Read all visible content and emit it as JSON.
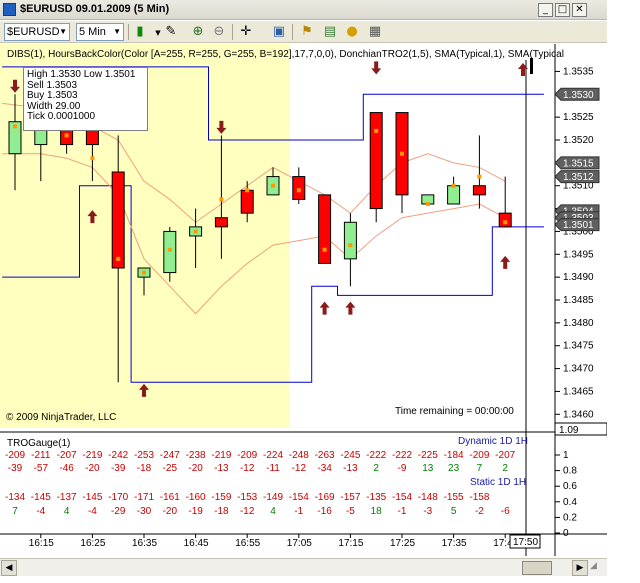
{
  "window": {
    "title": "$EURUSD  09.01.2009 (5 Min)",
    "minimize": "_",
    "restore": "□",
    "close": "✕"
  },
  "toolbar": {
    "instrument": "$EURUSD",
    "interval": "5 Min"
  },
  "indicator_label": "DIBS(1), HoursBackColor(Color [A=255, R=255, G=255, B=192],17,7,0,0), DonchianTRO2(1,5), SMA(Typical,1), SMA(Typical",
  "data_window": {
    "line1": "High 1.3530 Low 1.3501",
    "line2": "Sell 1.3503",
    "line3": "Buy 1.3503",
    "line4": "Width 29.00",
    "line5": "Tick 0.0001000"
  },
  "copyright": "© 2009 NinjaTrader, LLC",
  "time_remaining": "Time remaining = 00:00:00",
  "price_axis": {
    "ticks": [
      "1.3535",
      "1.3530",
      "1.3525",
      "1.3520",
      "1.3515",
      "1.3510",
      "1.3505",
      "1.3500",
      "1.3495",
      "1.3490",
      "1.3485",
      "1.3480",
      "1.3475",
      "1.3470",
      "1.3465",
      "1.3460"
    ],
    "markers": [
      {
        "label": "1.3530",
        "value": 1.353
      },
      {
        "label": "1.3515",
        "value": 1.3515
      },
      {
        "label": "1.3512",
        "value": 1.3512
      },
      {
        "label": "1.3504",
        "value": 1.35045
      },
      {
        "label": "1.3503",
        "value": 1.3503
      },
      {
        "label": "1.3501",
        "value": 1.35015
      }
    ]
  },
  "gauge": {
    "title": "TROGauge(1)",
    "axis_value": "1.09",
    "dynamic_label": "Dynamic 1D 1H",
    "static_label": "Static 1D 1H",
    "axis_ticks": [
      "1",
      "0.8",
      "0.6",
      "0.4",
      "0.2",
      "0"
    ],
    "row1": [
      "-209",
      "-211",
      "-207",
      "-219",
      "-242",
      "-253",
      "-247",
      "-238",
      "-219",
      "-209",
      "-224",
      "-248",
      "-263",
      "-245",
      "-222",
      "-222",
      "-225",
      "-184",
      "-209",
      "-207"
    ],
    "row2": [
      "-39",
      "-57",
      "-46",
      "-20",
      "-39",
      "-18",
      "-25",
      "-20",
      "-13",
      "-12",
      "-11",
      "-12",
      "-34",
      "-13",
      "2",
      "-9",
      "13",
      "23",
      "7",
      "2"
    ],
    "row3": [
      "-134",
      "-145",
      "-137",
      "-145",
      "-170",
      "-171",
      "-161",
      "-160",
      "-159",
      "-153",
      "-149",
      "-154",
      "-169",
      "-157",
      "-135",
      "-154",
      "-148",
      "-155",
      "-158"
    ],
    "row4": [
      "7",
      "-4",
      "4",
      "-4",
      "-29",
      "-30",
      "-20",
      "-19",
      "-18",
      "-12",
      "4",
      "-1",
      "-16",
      "-5",
      "18",
      "-1",
      "-3",
      "5",
      "-2",
      "-6"
    ]
  },
  "time_axis": {
    "labels": [
      "16:15",
      "16:25",
      "16:35",
      "16:45",
      "16:55",
      "17:05",
      "17:15",
      "17:25",
      "17:35",
      "17:4"
    ],
    "current": "17:50"
  },
  "colors": {
    "highlight_bg": "#ffffc0",
    "up_candle": "#90ee90",
    "down_candle": "#ff0000",
    "donchian": "#0000cc",
    "sma": "#f0a080",
    "arrow": "#8b1a1a",
    "positive": "#008000",
    "negative": "#cc0000",
    "label_blue": "#1a1aa6"
  },
  "chart_data": {
    "type": "candlestick",
    "x": [
      "16:10",
      "16:15",
      "16:20",
      "16:25",
      "16:30",
      "16:35",
      "16:40",
      "16:45",
      "16:50",
      "16:55",
      "17:00",
      "17:05",
      "17:10",
      "17:15",
      "17:20",
      "17:25",
      "17:30",
      "17:35",
      "17:40",
      "17:45",
      "17:50"
    ],
    "ylim": [
      1.3457,
      1.3541
    ],
    "ohlc": [
      [
        1.3517,
        1.353,
        1.3509,
        1.3524
      ],
      [
        1.3519,
        1.3529,
        1.3511,
        1.3524
      ],
      [
        1.3527,
        1.353,
        1.3517,
        1.3519
      ],
      [
        1.3524,
        1.3526,
        1.3511,
        1.3519
      ],
      [
        1.3513,
        1.3521,
        1.3467,
        1.3492
      ],
      [
        1.349,
        1.3492,
        1.3486,
        1.3492
      ],
      [
        1.3491,
        1.3501,
        1.3489,
        1.35
      ],
      [
        1.3499,
        1.3505,
        1.3492,
        1.3501
      ],
      [
        1.3503,
        1.3521,
        1.3494,
        1.3501
      ],
      [
        1.3509,
        1.3511,
        1.3502,
        1.3504
      ],
      [
        1.3508,
        1.3514,
        1.3508,
        1.3512
      ],
      [
        1.3512,
        1.3514,
        1.3506,
        1.3507
      ],
      [
        1.3508,
        1.3508,
        1.3493,
        1.3493
      ],
      [
        1.3494,
        1.3504,
        1.3488,
        1.3502
      ],
      [
        1.3526,
        1.3526,
        1.3502,
        1.3505
      ],
      [
        1.3526,
        1.3526,
        1.3504,
        1.3508
      ],
      [
        1.3506,
        1.3508,
        1.3506,
        1.3508
      ],
      [
        1.3506,
        1.3512,
        1.3506,
        1.351
      ],
      [
        1.351,
        1.3521,
        1.3505,
        1.3508
      ],
      [
        1.3504,
        1.3512,
        1.3501,
        1.3501
      ]
    ],
    "bar_markers": [
      1.3523,
      1.3523,
      1.3521,
      1.3516,
      1.3494,
      1.3491,
      1.3496,
      1.35,
      1.3507,
      1.3509,
      1.351,
      1.3509,
      1.3496,
      1.3497,
      1.3522,
      1.3517,
      1.3506,
      1.351,
      1.3512,
      1.3502
    ],
    "donchian_upper": [
      1.3536,
      1.3536,
      1.3536,
      1.3536,
      1.3536,
      1.3536,
      1.3536,
      1.3536,
      1.352,
      1.352,
      1.352,
      1.352,
      1.352,
      1.352,
      1.353,
      1.353,
      1.353,
      1.353,
      1.353,
      1.353,
      1.353
    ],
    "donchian_lower": [
      1.349,
      1.349,
      1.349,
      1.351,
      1.351,
      1.3467,
      1.3467,
      1.3467,
      1.3467,
      1.3467,
      1.3467,
      1.3467,
      1.3488,
      1.3486,
      1.3486,
      1.3486,
      1.3486,
      1.3486,
      1.3486,
      1.3501,
      1.3501
    ],
    "sma_upper": [
      1.3528,
      1.3527,
      1.3525,
      1.3523,
      1.352,
      1.3511,
      1.3507,
      1.3502,
      1.3506,
      1.351,
      1.3514,
      1.3511,
      1.3508,
      1.3504,
      1.351,
      1.3515,
      1.3517,
      1.3515,
      1.3514,
      1.3511
    ],
    "sma_lower": [
      1.3517,
      1.3517,
      1.3516,
      1.3514,
      1.3508,
      1.3494,
      1.3488,
      1.3482,
      1.3488,
      1.3493,
      1.3497,
      1.3498,
      1.3499,
      1.3494,
      1.3499,
      1.3503,
      1.3504,
      1.3505,
      1.3506,
      1.3503
    ],
    "arrows_down": [
      1.3531,
      1.3531,
      null,
      null,
      null,
      null,
      null,
      null,
      1.3522,
      null,
      null,
      null,
      null,
      null,
      1.3535,
      null,
      null,
      null,
      null,
      null
    ],
    "arrows_up": [
      null,
      null,
      null,
      1.3504,
      null,
      1.3466,
      null,
      null,
      null,
      null,
      null,
      null,
      1.3484,
      1.3484,
      null,
      null,
      null,
      null,
      null,
      1.3494
    ]
  }
}
